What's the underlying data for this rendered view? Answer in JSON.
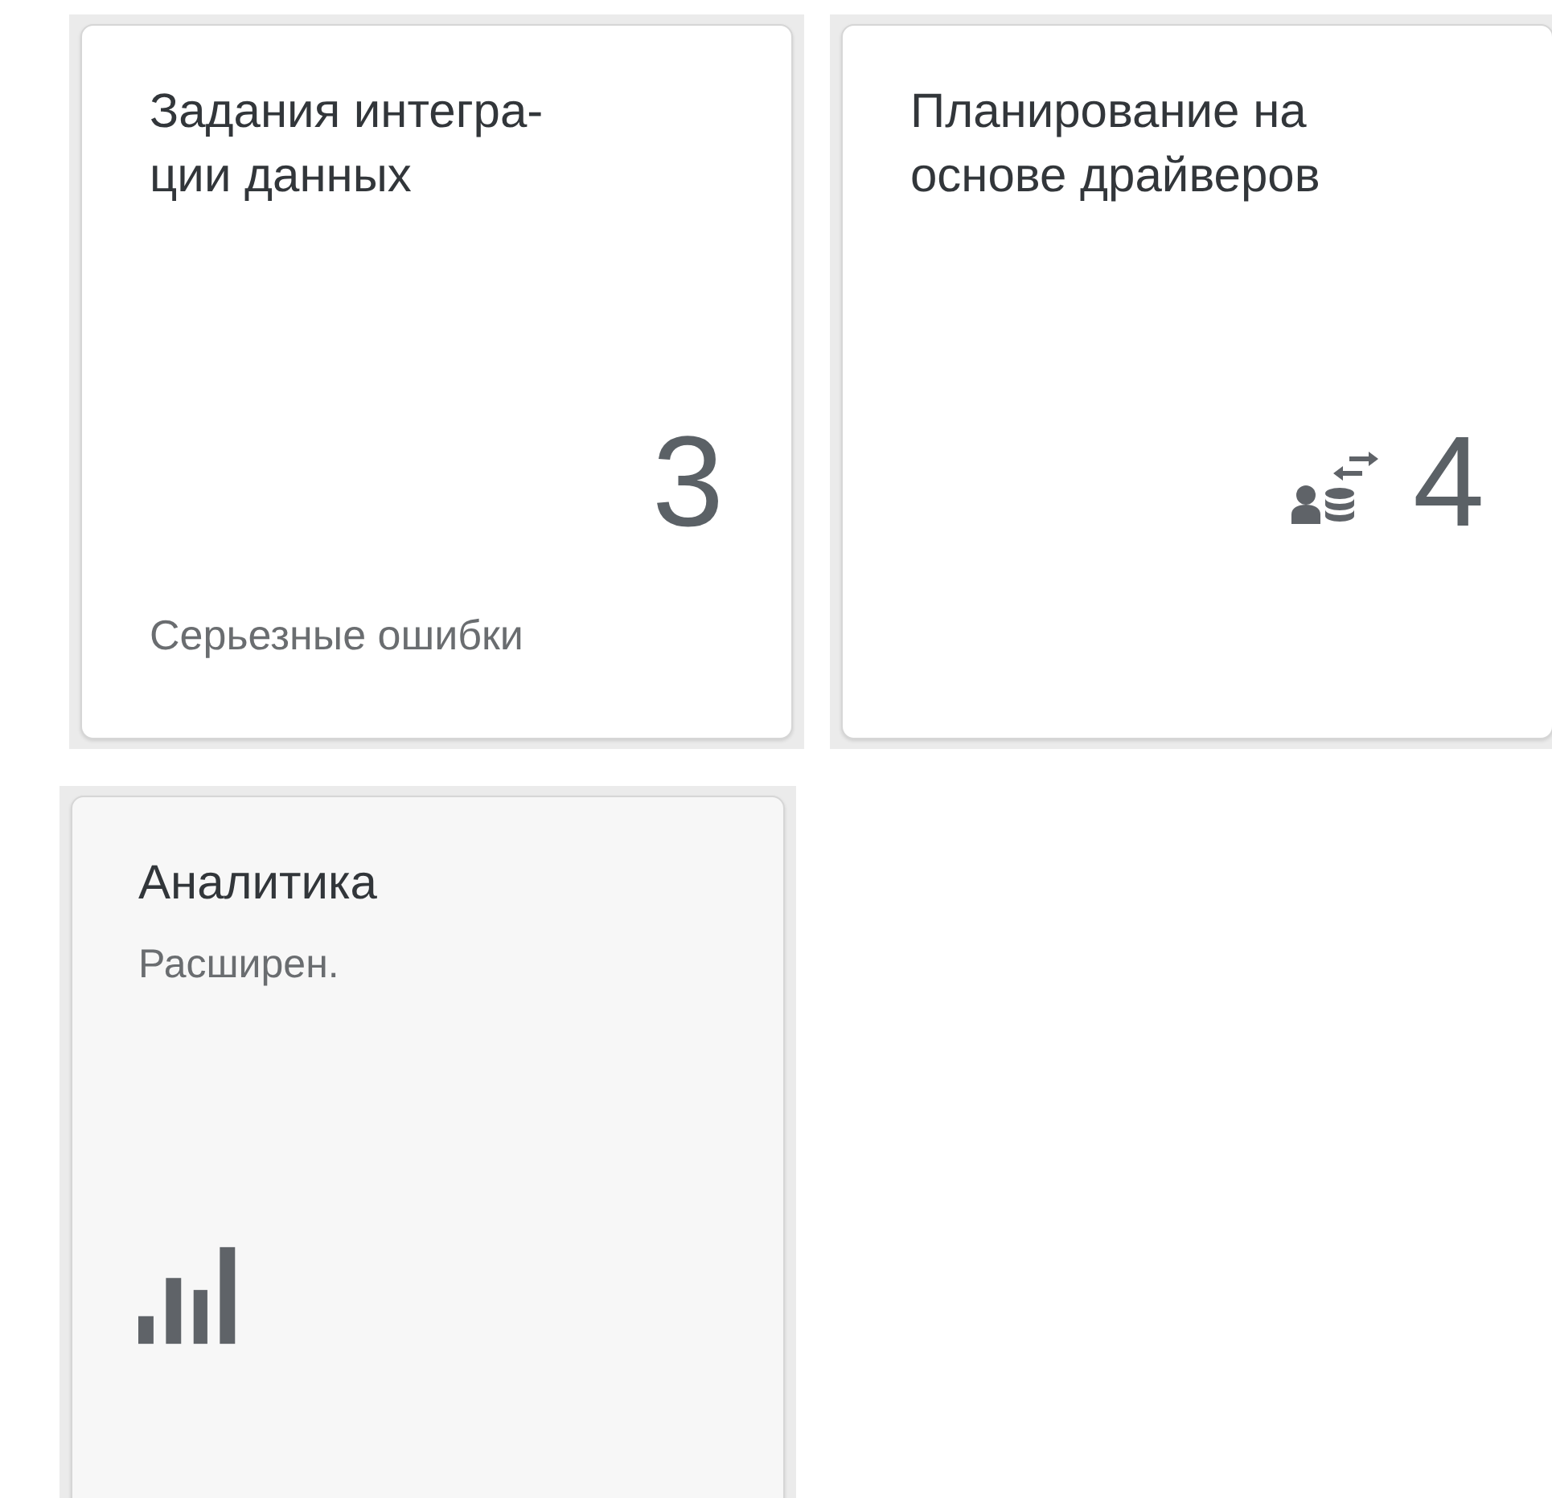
{
  "tiles": [
    {
      "kind": "kpi",
      "title": "Задания интегра-ции данных",
      "number": "3",
      "footer": "Серьезные ошибки"
    },
    {
      "kind": "kpi_icon",
      "title": "Планирование на основе драйверов",
      "number": "4"
    },
    {
      "kind": "launch",
      "title": "Аналитика",
      "subtitle": "Расширен."
    }
  ]
}
